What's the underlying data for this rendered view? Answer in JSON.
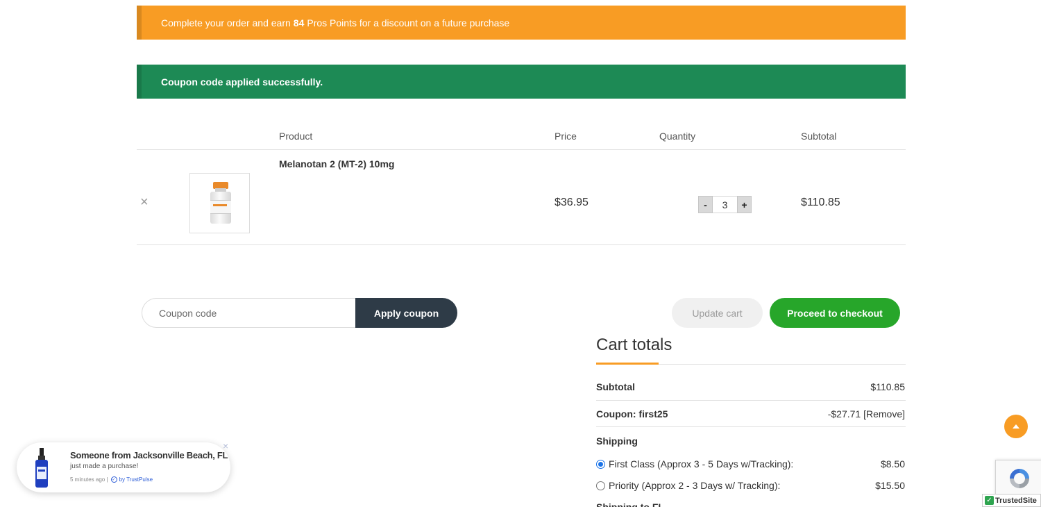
{
  "notices": {
    "points_before": "Complete your order and earn",
    "points_value": "84",
    "points_after": "Pros Points for a discount on a future purchase",
    "coupon_success": "Coupon code applied successfully."
  },
  "cart": {
    "headers": {
      "product": "Product",
      "price": "Price",
      "quantity": "Quantity",
      "subtotal": "Subtotal"
    },
    "items": [
      {
        "remove": "×",
        "name": "Melanotan 2 (MT-2) 10mg",
        "price": "$36.95",
        "quantity": "3",
        "minus": "-",
        "plus": "+",
        "subtotal": "$110.85"
      }
    ]
  },
  "actions": {
    "coupon_placeholder": "Coupon code",
    "apply_coupon": "Apply coupon",
    "update_cart": "Update cart",
    "proceed_checkout": "Proceed to checkout"
  },
  "totals": {
    "title": "Cart totals",
    "subtotal_label": "Subtotal",
    "subtotal_value": "$110.85",
    "coupon_label": "Coupon: first25",
    "coupon_value": "-$27.71",
    "coupon_remove": "[Remove]",
    "shipping_label": "Shipping",
    "shipping_options": [
      {
        "label": "First Class (Approx 3 - 5 Days w/Tracking):",
        "price": "$8.50",
        "selected": true
      },
      {
        "label": "Priority (Approx 2 - 3 Days w/ Tracking):",
        "price": "$15.50",
        "selected": false
      }
    ],
    "shipping_to": "Shipping to FL."
  },
  "popup": {
    "close": "×",
    "title": "Someone from Jacksonville Beach, FL",
    "subtitle": "just made a purchase!",
    "time": "5 minutes ago |",
    "by": "by TrustPulse"
  },
  "badges": {
    "trusted_site": "TrustedSite"
  },
  "colors": {
    "points_notice": "#f89c24",
    "success_notice": "#1d8a55",
    "checkout_green": "#27a62a",
    "coupon_button": "#2e3b47",
    "accent_orange": "#f89c24"
  }
}
